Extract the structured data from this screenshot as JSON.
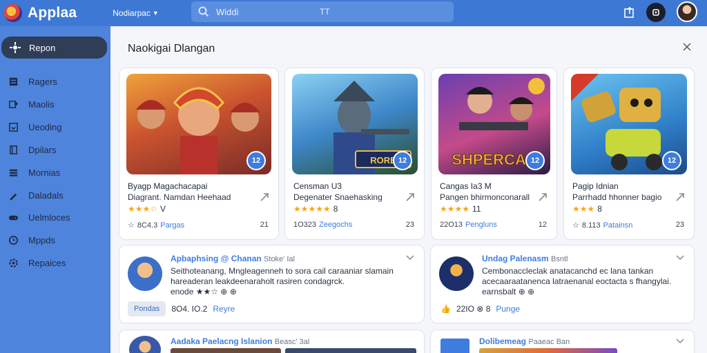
{
  "app": {
    "name": "Applaa",
    "category_label": "Nodiarpac"
  },
  "search": {
    "placeholder": "Widdi",
    "trailing": "TT"
  },
  "sidebar": {
    "active": "Repon",
    "items": [
      {
        "label": "Ragers",
        "icon": "news-icon"
      },
      {
        "label": "Maolis",
        "icon": "people-icon"
      },
      {
        "label": "Ueoding",
        "icon": "download-icon"
      },
      {
        "label": "Dpilars",
        "icon": "bookmark-icon"
      },
      {
        "label": "Mornias",
        "icon": "list-icon"
      },
      {
        "label": "Daladals",
        "icon": "pen-icon"
      },
      {
        "label": "Uelmloces",
        "icon": "gamepad-icon"
      },
      {
        "label": "Mppds",
        "icon": "clock-icon"
      },
      {
        "label": "Repaices",
        "icon": "settings-icon"
      }
    ]
  },
  "panel": {
    "title": "Naokigai Dlangan"
  },
  "games": [
    {
      "name": "Byagp Magachacapai",
      "subtitle": "Diagrant. Namdan Heehaad",
      "stars": "★★★☆",
      "rating": "V",
      "meta_num": "8C4.3",
      "meta_link": "Pargas",
      "count": "21",
      "badge": "12"
    },
    {
      "name": "Censman U3",
      "subtitle": "Degenater Snaehasking",
      "stars": "★★★★★",
      "rating": "8",
      "meta_num": "1O323",
      "meta_link": "Zeegochs",
      "count": "23",
      "badge": "12"
    },
    {
      "name": "Cangas Ia3 M",
      "subtitle": "Pangen bhirmonconarall",
      "stars": "★★★★",
      "rating": "11",
      "meta_num": "22O13",
      "meta_link": "Pengluns",
      "count": "12",
      "badge": "12"
    },
    {
      "name": "Pagip Idnian",
      "subtitle": "Parrhadd hhonner bagio",
      "stars": "★★★",
      "rating": "8",
      "meta_num": "8.113",
      "meta_link": "Patainsn",
      "count": "23",
      "badge": "12"
    }
  ],
  "game_art_text": {
    "card2": "RORE",
    "card3": "SHPERCAA"
  },
  "reviews": [
    {
      "title": "Apbaphsing @ Chanan",
      "tag": "Stoke' Ial",
      "body": "Seithoteanang, Mngleagenneh to sora cail caraaniar slamain hareaderan leakdeenaraholt rasiren condagrck.",
      "inline": "enode ★★☆ ⊕ ⊕",
      "pill": "Pondas",
      "num": "8O4. IO.2",
      "link": "Reyre"
    },
    {
      "title": "Undag Palenasm",
      "tag": "Bsntl",
      "body": "Cembonaccleclak anatacanchd ec lana tankan acecaaraatanenca latraenanal eoctacta s fhangylai.",
      "inline": "earnsbalt ⊕ ⊕",
      "pill": "",
      "num": "22IO ⊗ 8",
      "link": "Punge"
    }
  ],
  "partial_reviews": [
    {
      "title": "Aadaka Paelacng Islanion",
      "tag": "Beasc' 3al"
    },
    {
      "title": "Dolibemeag",
      "tag": "Paaeac Ban"
    }
  ]
}
